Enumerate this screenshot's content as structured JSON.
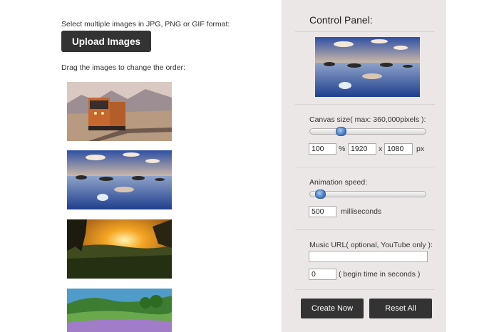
{
  "left": {
    "instruction": "Select multiple images in JPG, PNG or GIF format:",
    "upload_label": "Upload Images",
    "drag_hint": "Drag the images to change the order:",
    "images": [
      "train-image",
      "lake-image",
      "sunset-image",
      "flowers-image"
    ]
  },
  "panel": {
    "title": "Control Panel:",
    "canvas_label": "Canvas size( max: 360,000pixels ):",
    "canvas_percent": "100",
    "percent_sign": "%",
    "width_value": "1920",
    "x_sep": "x",
    "height_value": "1080",
    "px_unit": "px",
    "speed_label": "Animation speed:",
    "speed_value": "500",
    "ms_unit": "milliseconds",
    "music_label": "Music URL( optional, YouTube only ):",
    "music_value": "",
    "begin_value": "0",
    "begin_label": "( begin time in seconds )",
    "create_label": "Create Now",
    "reset_label": "Reset All"
  },
  "colors": {
    "button_bg": "#333333",
    "panel_bg": "#ece7e7",
    "knob": "#3c72bf"
  }
}
